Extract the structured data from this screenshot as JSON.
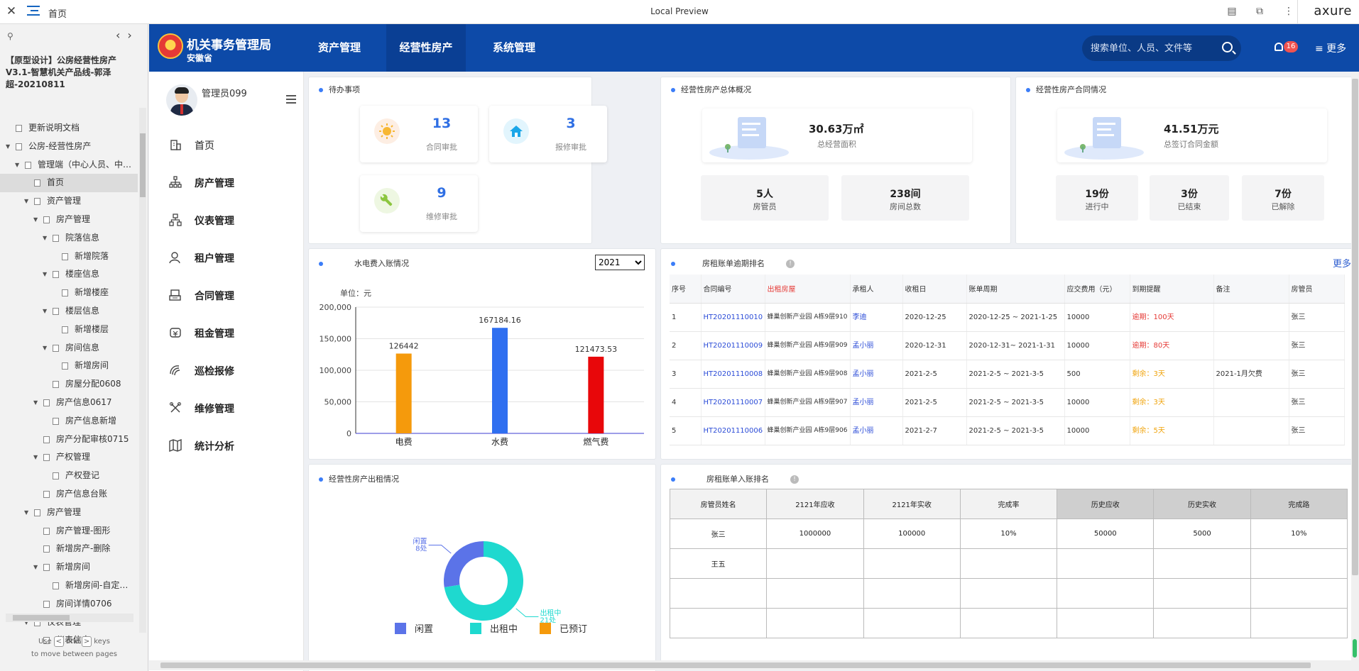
{
  "preview": {
    "page_name": "首页",
    "title": "Local Preview",
    "brand": "axure"
  },
  "sitemap": {
    "project_title": "【原型设计】公房经营性房产V3.1-智慧机关产品线-郭泽超-20210811",
    "items": [
      {
        "label": "更新说明文档",
        "level": 0,
        "twisty": "",
        "selected": false
      },
      {
        "label": "公房-经营性房产",
        "level": 0,
        "twisty": "▼",
        "selected": false
      },
      {
        "label": "管理端（中心人员、中…",
        "level": 1,
        "twisty": "▼",
        "selected": false
      },
      {
        "label": "首页",
        "level": 2,
        "twisty": "",
        "selected": true
      },
      {
        "label": "资产管理",
        "level": 2,
        "twisty": "▼",
        "selected": false
      },
      {
        "label": "房产管理",
        "level": 3,
        "twisty": "▼",
        "selected": false
      },
      {
        "label": "院落信息",
        "level": 4,
        "twisty": "▼",
        "selected": false
      },
      {
        "label": "新增院落",
        "level": 5,
        "twisty": "",
        "selected": false
      },
      {
        "label": "楼座信息",
        "level": 4,
        "twisty": "▼",
        "selected": false
      },
      {
        "label": "新增楼座",
        "level": 5,
        "twisty": "",
        "selected": false
      },
      {
        "label": "楼层信息",
        "level": 4,
        "twisty": "▼",
        "selected": false
      },
      {
        "label": "新增楼层",
        "level": 5,
        "twisty": "",
        "selected": false
      },
      {
        "label": "房间信息",
        "level": 4,
        "twisty": "▼",
        "selected": false
      },
      {
        "label": "新增房间",
        "level": 5,
        "twisty": "",
        "selected": false
      },
      {
        "label": "房屋分配0608",
        "level": 4,
        "twisty": "",
        "selected": false
      },
      {
        "label": "房产信息0617",
        "level": 3,
        "twisty": "▼",
        "selected": false
      },
      {
        "label": "房产信息新增",
        "level": 4,
        "twisty": "",
        "selected": false
      },
      {
        "label": "房产分配审核0715",
        "level": 3,
        "twisty": "",
        "selected": false
      },
      {
        "label": "产权管理",
        "level": 3,
        "twisty": "▼",
        "selected": false
      },
      {
        "label": "产权登记",
        "level": 4,
        "twisty": "",
        "selected": false
      },
      {
        "label": "房产信息台账",
        "level": 3,
        "twisty": "",
        "selected": false
      },
      {
        "label": "房产管理",
        "level": 2,
        "twisty": "▼",
        "selected": false
      },
      {
        "label": "房产管理-图形",
        "level": 3,
        "twisty": "",
        "selected": false
      },
      {
        "label": "新增房产-删除",
        "level": 3,
        "twisty": "",
        "selected": false
      },
      {
        "label": "新增房间",
        "level": 3,
        "twisty": "▼",
        "selected": false
      },
      {
        "label": "新增房间-自定…",
        "level": 4,
        "twisty": "",
        "selected": false
      },
      {
        "label": "房间详情0706",
        "level": 3,
        "twisty": "",
        "selected": false
      },
      {
        "label": "仪表管理",
        "level": 2,
        "twisty": "▼",
        "selected": false
      },
      {
        "label": "仪表信息",
        "level": 3,
        "twisty": "",
        "selected": false
      }
    ],
    "keys_hint_pre": "Use",
    "keys_hint_and": "and",
    "keys_hint_post": "keys",
    "keys_hint_line2": "to move between pages",
    "key_left": "<",
    "key_right": ">"
  },
  "header": {
    "org_name": "机关事务管理局",
    "province": "安徽省",
    "nav": [
      "资产管理",
      "经营性房产",
      "系统管理"
    ],
    "active_nav": "经营性房产",
    "search_placeholder": "搜索单位、人员、文件等",
    "notification_count": "16",
    "more_label": "≡ 更多"
  },
  "user": {
    "name": "管理员099"
  },
  "menu": [
    {
      "label": "首页",
      "icon": "building-icon"
    },
    {
      "label": "房产管理",
      "icon": "org-tree-icon"
    },
    {
      "label": "仪表管理",
      "icon": "meter-icon"
    },
    {
      "label": "租户管理",
      "icon": "user-icon"
    },
    {
      "label": "合同管理",
      "icon": "contract-icon"
    },
    {
      "label": "租金管理",
      "icon": "money-icon"
    },
    {
      "label": "巡检报修",
      "icon": "inspect-icon"
    },
    {
      "label": "维修管理",
      "icon": "wrench-icon"
    },
    {
      "label": "统计分析",
      "icon": "map-icon"
    }
  ],
  "todo": {
    "title": "待办事项",
    "items": [
      {
        "value": "13",
        "label": "合同审批",
        "color": "#f7b733",
        "bg": "#fdeee3",
        "icon": "sun-icon"
      },
      {
        "value": "3",
        "label": "报修审批",
        "color": "#1aa6e8",
        "bg": "#e2f5fd",
        "icon": "house-icon"
      },
      {
        "value": "9",
        "label": "维修审批",
        "color": "#8cc63f",
        "bg": "#eef7e2",
        "icon": "wrench-icon"
      }
    ]
  },
  "overview": {
    "title": "经营性房产总体概况",
    "area_value": "30.63万㎡",
    "area_label": "总经营面积",
    "stats": [
      {
        "value": "5人",
        "label": "房管员"
      },
      {
        "value": "238间",
        "label": "房间总数"
      }
    ]
  },
  "contracts": {
    "title": "经营性房产合同情况",
    "amount_value": "41.51万元",
    "amount_label": "总签订合同金额",
    "stats": [
      {
        "value": "19份",
        "label": "进行中"
      },
      {
        "value": "3份",
        "label": "已结束"
      },
      {
        "value": "7份",
        "label": "已解除"
      }
    ]
  },
  "utility": {
    "title": "水电费入账情况",
    "year": "2021",
    "year_options": [
      "2021"
    ],
    "unit_label": "单位：元"
  },
  "chart_data": [
    {
      "type": "bar",
      "title": "水电费入账情况",
      "categories": [
        "电费",
        "水费",
        "燃气费"
      ],
      "values": [
        126442,
        167184.16,
        121473.53
      ],
      "value_labels": [
        "126442",
        "167184.16",
        "121473.53"
      ],
      "colors": [
        "#f59a0c",
        "#2f6ff0",
        "#e8070a"
      ],
      "ylabel": "单位：元",
      "ylim": [
        0,
        200000
      ],
      "yticks": [
        0,
        50000,
        100000,
        150000,
        200000
      ],
      "ytick_labels": [
        "0",
        "50,000",
        "100,000",
        "150,000",
        "200,000"
      ],
      "grid": true
    },
    {
      "type": "pie",
      "title": "经营性房产出租情况",
      "donut": true,
      "slices": [
        {
          "name": "闲置",
          "value": 8,
          "color": "#5b73e8",
          "label": "闲置\n8处"
        },
        {
          "name": "出租中",
          "value": 21,
          "color": "#1ed9cf",
          "label": "出租中\n21处"
        },
        {
          "name": "已预订",
          "value": 0,
          "color": "#f59a0c",
          "label": ""
        }
      ],
      "legend": [
        "闲置",
        "出租中",
        "已预订"
      ],
      "legend_position": "bottom"
    }
  ],
  "rent_ranking": {
    "title": "房租账单逾期排名",
    "more": "更多",
    "columns": [
      "序号",
      "合同编号",
      "出租房屋",
      "承租人",
      "收租日",
      "账单周期",
      "应交费用（元）",
      "到期提醒",
      "备注",
      "房管员"
    ],
    "rows": [
      {
        "no": "1",
        "contract": "HT20201110010",
        "room": "蜂巢创新产业园 A栋9层910",
        "tenant": "李迪",
        "day": "2020-12-25",
        "period": "2020-12-25 ~ 2021-1-25",
        "fee": "10000",
        "remind_pre": "逾期：",
        "remind_val": "100天",
        "remind_type": "overdue",
        "note": "",
        "manager": "张三"
      },
      {
        "no": "2",
        "contract": "HT20201110009",
        "room": "蜂巢创新产业园 A栋9层909",
        "tenant": "孟小丽",
        "day": "2020-12-31",
        "period": "2020-12-31~ 2021-1-31",
        "fee": "10000",
        "remind_pre": "逾期：",
        "remind_val": "80天",
        "remind_type": "overdue",
        "note": "",
        "manager": "张三"
      },
      {
        "no": "3",
        "contract": "HT20201110008",
        "room": "蜂巢创新产业园 A栋9层908",
        "tenant": "孟小丽",
        "day": "2021-2-5",
        "period": "2021-2-5 ~ 2021-3-5",
        "fee": "500",
        "remind_pre": "剩余：",
        "remind_val": "3天",
        "remind_type": "remain",
        "note": "2021-1月欠费",
        "manager": "张三"
      },
      {
        "no": "4",
        "contract": "HT20201110007",
        "room": "蜂巢创新产业园 A栋9层907",
        "tenant": "孟小丽",
        "day": "2021-2-5",
        "period": "2021-2-5 ~ 2021-3-5",
        "fee": "10000",
        "remind_pre": "剩余：",
        "remind_val": "3天",
        "remind_type": "remain",
        "note": "",
        "manager": "张三"
      },
      {
        "no": "5",
        "contract": "HT20201110006",
        "room": "蜂巢创新产业园 A栋9层906",
        "tenant": "孟小丽",
        "day": "2021-2-7",
        "period": "2021-2-5 ~ 2021-3-5",
        "fee": "10000",
        "remind_pre": "剩余：",
        "remind_val": "5天",
        "remind_type": "remain",
        "note": "",
        "manager": "张三"
      }
    ]
  },
  "rent_income": {
    "title": "房租账单入账排名",
    "columns": [
      "房管员姓名",
      "2121年应收",
      "2121年实收",
      "完成率",
      "历史应收",
      "历史实收",
      "完成路"
    ],
    "rows": [
      [
        "张三",
        "1000000",
        "100000",
        "10%",
        "50000",
        "5000",
        "10%"
      ],
      [
        "王五",
        "",
        "",
        "",
        "",
        "",
        ""
      ],
      [
        "",
        "",
        "",
        "",
        "",
        "",
        ""
      ],
      [
        "",
        "",
        "",
        "",
        "",
        "",
        ""
      ]
    ]
  },
  "occupancy": {
    "title": "经营性房产出租情况"
  }
}
